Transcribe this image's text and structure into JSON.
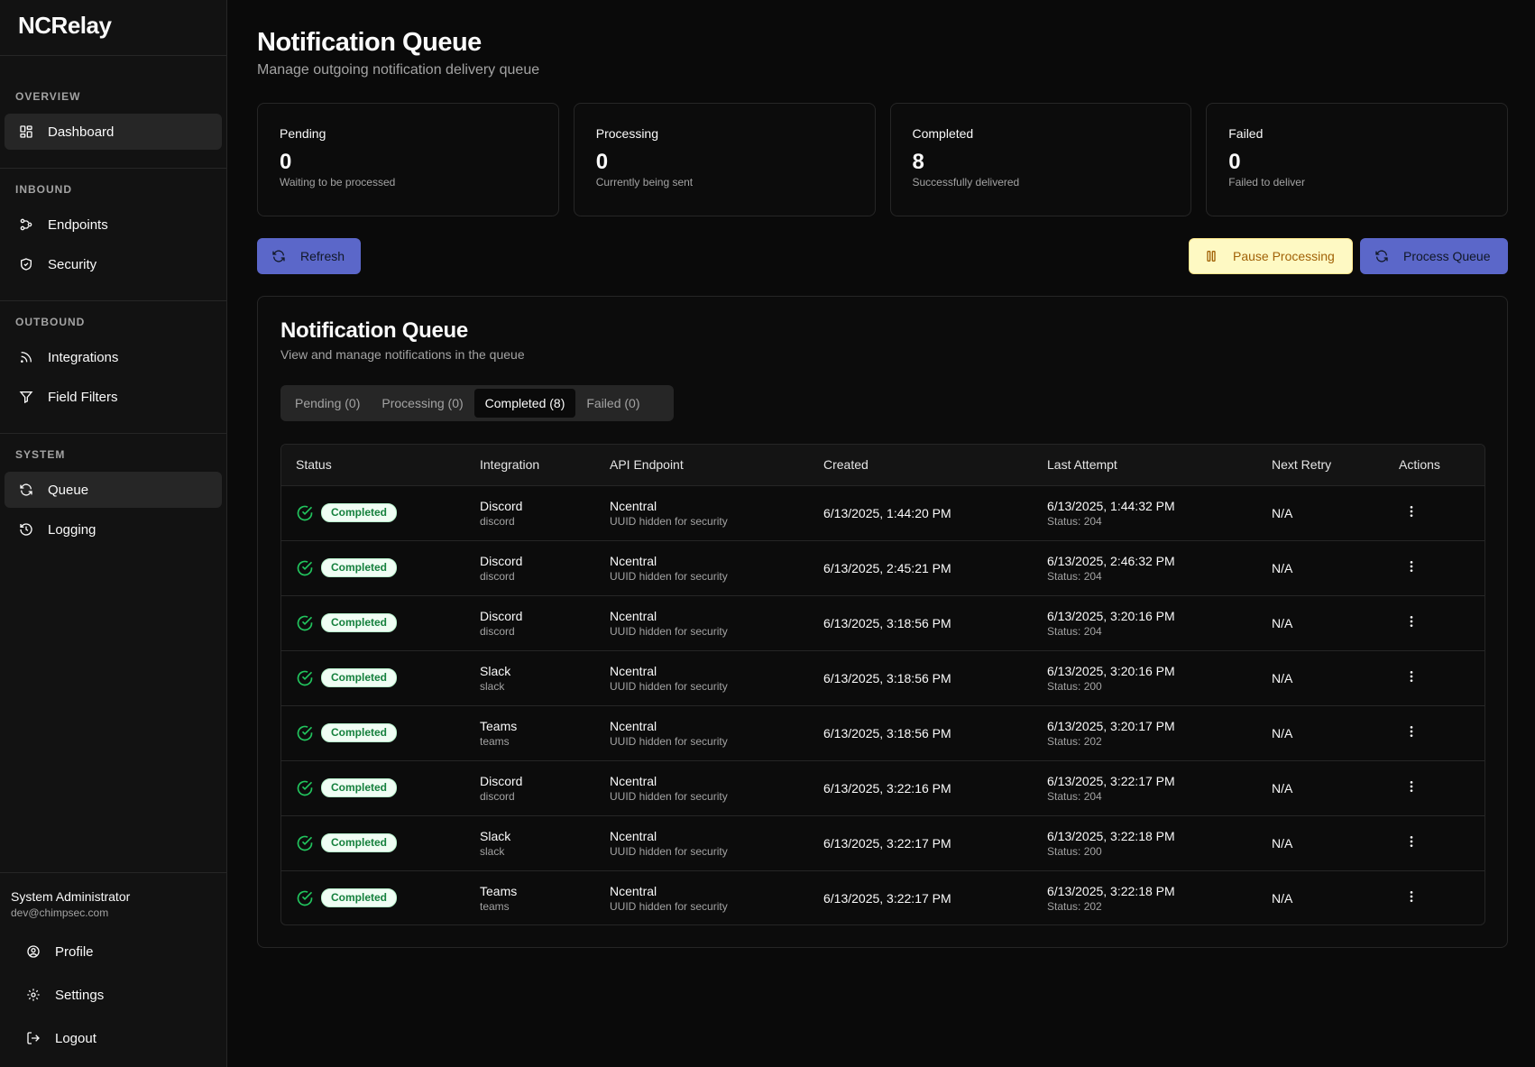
{
  "app": {
    "name": "NCRelay"
  },
  "sidebar": {
    "sections": [
      {
        "label": "OVERVIEW",
        "items": [
          {
            "label": "Dashboard",
            "icon": "dashboard-icon"
          }
        ]
      },
      {
        "label": "INBOUND",
        "items": [
          {
            "label": "Endpoints",
            "icon": "endpoints-icon"
          },
          {
            "label": "Security",
            "icon": "shield-icon"
          }
        ]
      },
      {
        "label": "OUTBOUND",
        "items": [
          {
            "label": "Integrations",
            "icon": "rss-icon"
          },
          {
            "label": "Field Filters",
            "icon": "filter-icon"
          }
        ]
      },
      {
        "label": "SYSTEM",
        "items": [
          {
            "label": "Queue",
            "icon": "refresh-icon"
          },
          {
            "label": "Logging",
            "icon": "history-icon"
          }
        ]
      }
    ],
    "user": {
      "name": "System Administrator",
      "email": "dev@chimpsec.com",
      "menu": [
        {
          "label": "Profile"
        },
        {
          "label": "Settings"
        },
        {
          "label": "Logout"
        }
      ]
    }
  },
  "header": {
    "title": "Notification Queue",
    "subtitle": "Manage outgoing notification delivery queue"
  },
  "stats": [
    {
      "label": "Pending",
      "value": "0",
      "desc": "Waiting to be processed"
    },
    {
      "label": "Processing",
      "value": "0",
      "desc": "Currently being sent"
    },
    {
      "label": "Completed",
      "value": "8",
      "desc": "Successfully delivered"
    },
    {
      "label": "Failed",
      "value": "0",
      "desc": "Failed to deliver"
    }
  ],
  "toolbar": {
    "refresh": "Refresh",
    "pause": "Pause Processing",
    "process": "Process Queue"
  },
  "queue": {
    "title": "Notification Queue",
    "subtitle": "View and manage notifications in the queue",
    "tabs": [
      {
        "label": "Pending (0)"
      },
      {
        "label": "Processing (0)"
      },
      {
        "label": "Completed (8)",
        "active": true
      },
      {
        "label": "Failed (0)"
      }
    ],
    "columns": [
      "Status",
      "Integration",
      "API Endpoint",
      "Created",
      "Last Attempt",
      "Next Retry",
      "Actions"
    ],
    "rows": [
      {
        "status": "Completed",
        "integration": "Discord",
        "integration_type": "discord",
        "endpoint": "Ncentral",
        "endpoint_note": "UUID hidden for security",
        "created": "6/13/2025, 1:44:20 PM",
        "last_attempt": "6/13/2025, 1:44:32 PM",
        "last_status": "Status: 204",
        "next_retry": "N/A"
      },
      {
        "status": "Completed",
        "integration": "Discord",
        "integration_type": "discord",
        "endpoint": "Ncentral",
        "endpoint_note": "UUID hidden for security",
        "created": "6/13/2025, 2:45:21 PM",
        "last_attempt": "6/13/2025, 2:46:32 PM",
        "last_status": "Status: 204",
        "next_retry": "N/A"
      },
      {
        "status": "Completed",
        "integration": "Discord",
        "integration_type": "discord",
        "endpoint": "Ncentral",
        "endpoint_note": "UUID hidden for security",
        "created": "6/13/2025, 3:18:56 PM",
        "last_attempt": "6/13/2025, 3:20:16 PM",
        "last_status": "Status: 204",
        "next_retry": "N/A"
      },
      {
        "status": "Completed",
        "integration": "Slack",
        "integration_type": "slack",
        "endpoint": "Ncentral",
        "endpoint_note": "UUID hidden for security",
        "created": "6/13/2025, 3:18:56 PM",
        "last_attempt": "6/13/2025, 3:20:16 PM",
        "last_status": "Status: 200",
        "next_retry": "N/A"
      },
      {
        "status": "Completed",
        "integration": "Teams",
        "integration_type": "teams",
        "endpoint": "Ncentral",
        "endpoint_note": "UUID hidden for security",
        "created": "6/13/2025, 3:18:56 PM",
        "last_attempt": "6/13/2025, 3:20:17 PM",
        "last_status": "Status: 202",
        "next_retry": "N/A"
      },
      {
        "status": "Completed",
        "integration": "Discord",
        "integration_type": "discord",
        "endpoint": "Ncentral",
        "endpoint_note": "UUID hidden for security",
        "created": "6/13/2025, 3:22:16 PM",
        "last_attempt": "6/13/2025, 3:22:17 PM",
        "last_status": "Status: 204",
        "next_retry": "N/A"
      },
      {
        "status": "Completed",
        "integration": "Slack",
        "integration_type": "slack",
        "endpoint": "Ncentral",
        "endpoint_note": "UUID hidden for security",
        "created": "6/13/2025, 3:22:17 PM",
        "last_attempt": "6/13/2025, 3:22:18 PM",
        "last_status": "Status: 200",
        "next_retry": "N/A"
      },
      {
        "status": "Completed",
        "integration": "Teams",
        "integration_type": "teams",
        "endpoint": "Ncentral",
        "endpoint_note": "UUID hidden for security",
        "created": "6/13/2025, 3:22:17 PM",
        "last_attempt": "6/13/2025, 3:22:18 PM",
        "last_status": "Status: 202",
        "next_retry": "N/A"
      }
    ]
  },
  "colors": {
    "background": "#0a0a0a",
    "sidebar": "#121212",
    "border": "#262626",
    "primary": "#5b67c9",
    "pause_bg": "#fef9c3",
    "pause_text": "#a16207",
    "success": "#22c55e"
  }
}
